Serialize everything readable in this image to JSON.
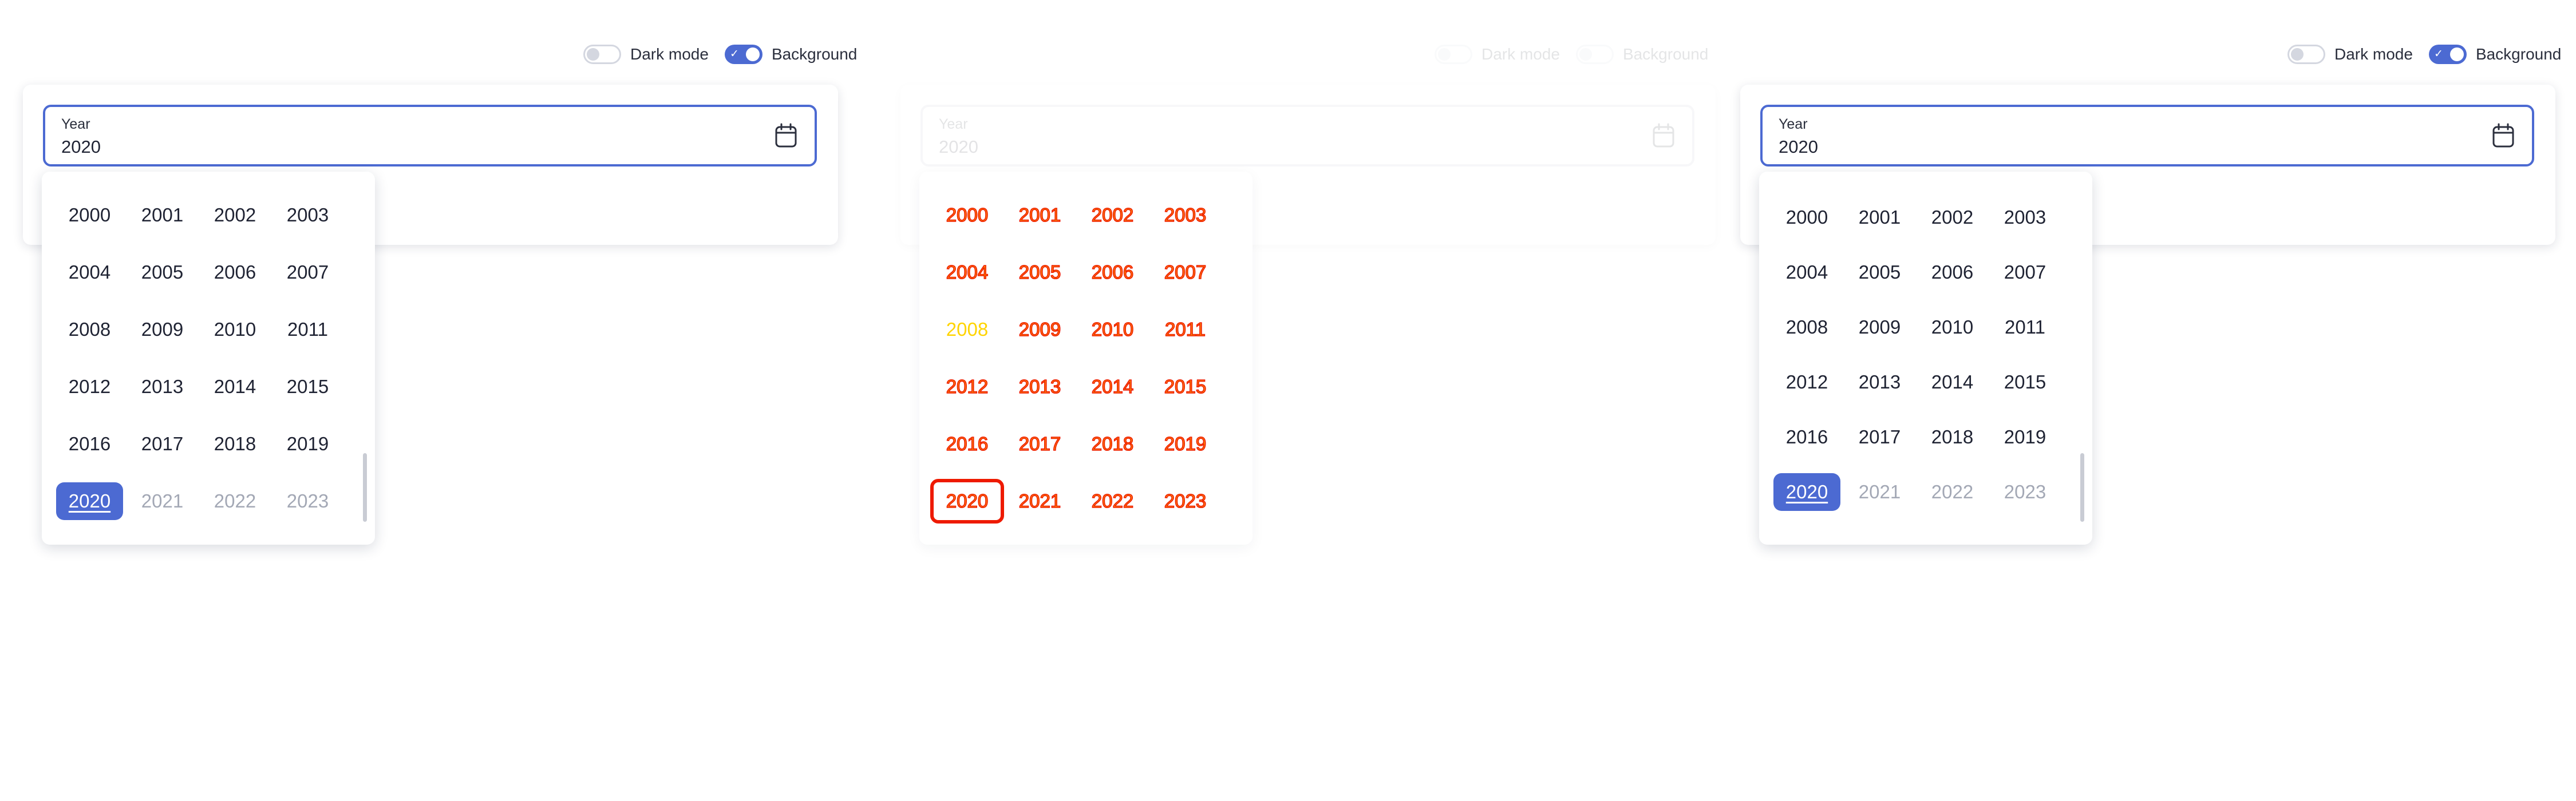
{
  "toggles": {
    "dark_mode": "Dark mode",
    "background": "Background"
  },
  "field": {
    "label": "Year",
    "value": "2020"
  },
  "years": [
    "2000",
    "2001",
    "2002",
    "2003",
    "2004",
    "2005",
    "2006",
    "2007",
    "2008",
    "2009",
    "2010",
    "2011",
    "2012",
    "2013",
    "2014",
    "2015",
    "2016",
    "2017",
    "2018",
    "2019",
    "2020",
    "2021",
    "2022",
    "2023"
  ],
  "selected_year": "2020",
  "disabled_years": [
    "2021",
    "2022",
    "2023"
  ],
  "colors": {
    "accent": "#4c6ad2",
    "debug_fill": "#ff8a00",
    "debug_stroke": "#ee1a00",
    "debug_highlight": "#ffd400"
  },
  "icons": [
    "check-icon",
    "calendar-icon"
  ]
}
